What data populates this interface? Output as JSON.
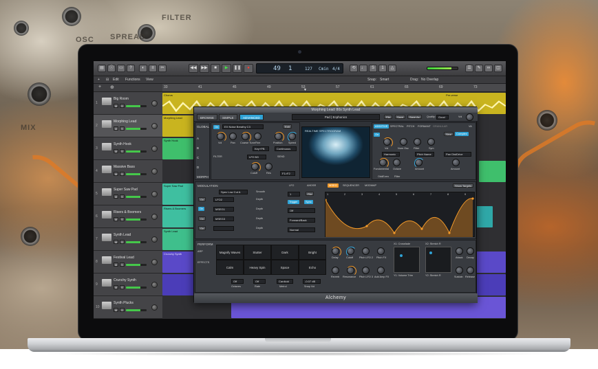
{
  "background": {
    "labels": [
      "SPREAD",
      "OSC",
      "FILTER",
      "MIX"
    ]
  },
  "toolbar": {
    "lcd": {
      "bar": "49",
      "beat": "1",
      "tempo": "127",
      "key": "Cmin",
      "signature": "4/4"
    }
  },
  "menubar": {
    "items": [
      "Edit",
      "Functions",
      "View"
    ],
    "snap_label": "Snap:",
    "snap_value": "Smart",
    "drag_label": "Drag:",
    "drag_value": "No Overlap"
  },
  "ruler": {
    "marks": [
      "33",
      "41",
      "45",
      "49",
      "53",
      "57",
      "61",
      "65",
      "69",
      "73"
    ]
  },
  "tracks": [
    {
      "num": "1",
      "name": "Big Room"
    },
    {
      "num": "2",
      "name": "Morphing Lead"
    },
    {
      "num": "3",
      "name": "Synth Hook"
    },
    {
      "num": "4",
      "name": "Massive Bass"
    },
    {
      "num": "5",
      "name": "Super Saw Pad"
    },
    {
      "num": "6",
      "name": "Risers & Boomers"
    },
    {
      "num": "7",
      "name": "Synth Lead"
    },
    {
      "num": "8",
      "name": "Festival Lead"
    },
    {
      "num": "9",
      "name": "Crunchy Synth"
    },
    {
      "num": "10",
      "name": "Synth Plucks"
    }
  ],
  "regions": {
    "chorus": "Chorus",
    "prechorus": "Pre-verse",
    "morphing_lead": "Morphing Lead",
    "synth_hook": "Synth Hook",
    "super_saw_pad": "Super Saw Pad",
    "risers": "Risers & Boomers",
    "synth_lead": "Synth Lead",
    "crunchy_synth": "Crunchy Synth"
  },
  "alchemy": {
    "window_title": "Morphing Lead: 80s Synth Lead",
    "tabs": [
      "BROWSE",
      "SIMPLE",
      "ADVANCED"
    ],
    "preset": "Pad | Ecphonics",
    "file_buttons": [
      "File",
      "Save",
      "Save As"
    ],
    "quality_label": "Quality:",
    "quality_value": "Good",
    "vol_label": "Vol",
    "sidebar": [
      "GLOBAL",
      "A",
      "B",
      "C",
      "D",
      "MORPH"
    ],
    "source": {
      "on": "On",
      "name": "EX Noise Breathy C3",
      "edit": "Edit",
      "knobs": [
        "Vol",
        "Pan",
        "Coarse Tune",
        "Fine"
      ],
      "knobs2": [
        "Position",
        "Speed"
      ],
      "key_label": "Key+PB",
      "loop": "Continuous"
    },
    "filter": {
      "label": "FILTER",
      "type": "LP2 BG",
      "send_label": "SEND",
      "send_value": "F1>F2",
      "knobs": [
        "Cutoff",
        "Res"
      ]
    },
    "spectro_label": "REALTIME SPECTROGRAM",
    "additive_tabs": [
      "ADDITIVE",
      "SPECTRAL",
      "PITCH",
      "FORMANT",
      "GRANULAR",
      "VA"
    ],
    "right": {
      "on": "On",
      "sine": "Sine",
      "complex": "Complex",
      "knobs": [
        "Vol",
        "Num Osc",
        "Filter",
        "Sym"
      ],
      "harmonic": "Harmonic",
      "pitch_name": "Pitch Name",
      "pan_dest": "Pan DistDrive",
      "knobs2": [
        "Fundamental",
        "Octave",
        "Amount"
      ],
      "knobs3": [
        "OddEven",
        "Filter"
      ]
    },
    "modulation": {
      "label": "MODULATION",
      "target": "Spec Low Cut A",
      "smooth": "Smooth",
      "rows": [
        {
          "on": "On",
          "src": "LFO2",
          "depth": "Depth"
        },
        {
          "on": "On",
          "src": "MSEG1",
          "depth": "Depth"
        },
        {
          "on": "On",
          "src": "MSEG3",
          "depth": "Depth"
        },
        {
          "on": "On",
          "src": "",
          "depth": "Depth"
        }
      ],
      "tabs": [
        "LFO",
        "AHDSR",
        "MSEG",
        "SEQUENCER",
        "MODMAP"
      ],
      "show_targets": "Show Targets",
      "mseg_num": "1",
      "file": "File",
      "trigger": "Trigger",
      "sync": "Sync",
      "off": "Off",
      "loop_mode": "Forward/Back",
      "normal": "Normal",
      "grid_marks": [
        "1",
        "2",
        "3",
        "4",
        "5",
        "6",
        "7",
        "8",
        "9"
      ]
    },
    "perform": {
      "label": "PERFORM",
      "side_tabs": [
        "ARP",
        "EFFECTS"
      ],
      "pads": [
        "Magnify Waves",
        "Stutter",
        "Dark",
        "Bright",
        "Calm",
        "Heavy Spin",
        "Space",
        "Echo"
      ],
      "bottom_values": [
        "Off",
        "Off",
        "Cardioid",
        "-0.07 dB"
      ],
      "bottom_labels": [
        "Octaves",
        "Rate",
        "Metrol",
        "Snap Vol"
      ],
      "knobs_row1": [
        "Delay",
        "Cutoff",
        "Pitch LFO 2",
        "Pitch FX"
      ],
      "knobs_row2": [
        "Reverb",
        "Resonance",
        "Pitch LFO 3",
        "Add Amp FX"
      ],
      "xy1_label": "X1: Crossfade",
      "xy1_bottom": "Y1: Volume Trim",
      "xy2_label": "X2: Stretch R",
      "xy2_bottom": "Y2: Stretch R",
      "right_knobs": [
        "Attack",
        "Decay",
        "Sustain",
        "Release"
      ]
    },
    "footer": "Alchemy"
  },
  "colors": {
    "accent": "#2fa3d6",
    "orange": "#f39a2a",
    "audio_green": "#3fbf8c",
    "yellow_region": "#c8b41e",
    "purple_region": "#5a49c8"
  }
}
